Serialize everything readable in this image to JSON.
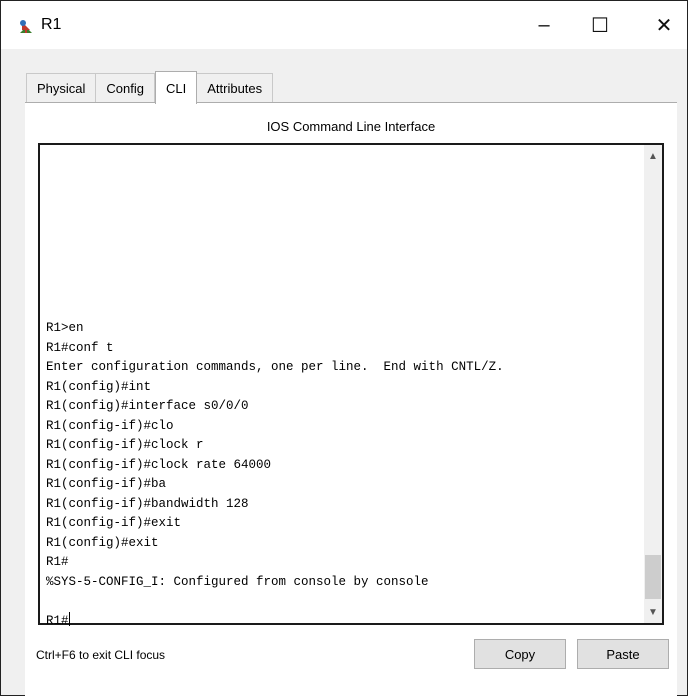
{
  "window": {
    "title": "R1",
    "controls": {
      "minimize": "–",
      "maximize": "☐",
      "close": "✕"
    }
  },
  "tabs": [
    {
      "label": "Physical",
      "active": false
    },
    {
      "label": "Config",
      "active": false
    },
    {
      "label": "CLI",
      "active": true
    },
    {
      "label": "Attributes",
      "active": false
    }
  ],
  "panel": {
    "title": "IOS Command Line Interface"
  },
  "console": {
    "lines": [
      "R1>en",
      "R1#conf t",
      "Enter configuration commands, one per line.  End with CNTL/Z.",
      "R1(config)#int",
      "R1(config)#interface s0/0/0",
      "R1(config-if)#clo",
      "R1(config-if)#clock r",
      "R1(config-if)#clock rate 64000",
      "R1(config-if)#ba",
      "R1(config-if)#bandwidth 128",
      "R1(config-if)#exit",
      "R1(config)#exit",
      "R1#",
      "%SYS-5-CONFIG_I: Configured from console by console",
      "",
      "R1#"
    ]
  },
  "footer": {
    "hint": "Ctrl+F6 to exit CLI focus",
    "copy_label": "Copy",
    "paste_label": "Paste"
  }
}
